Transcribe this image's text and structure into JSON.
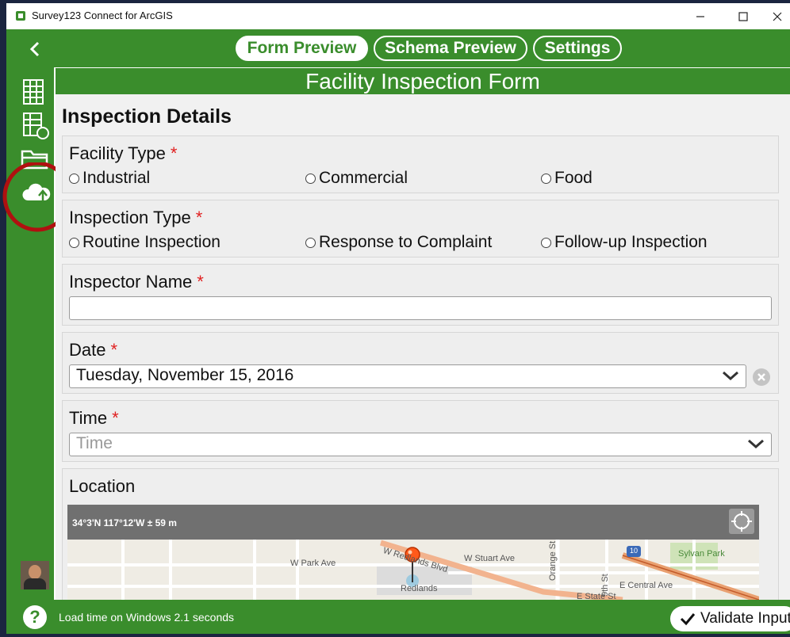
{
  "window": {
    "title": "Survey123 Connect for ArcGIS",
    "icon": "survey123-app-icon"
  },
  "window_controls": [
    "minimize-icon",
    "maximize-icon",
    "close-icon"
  ],
  "tabs": [
    {
      "label": "Form Preview",
      "active": true
    },
    {
      "label": "Schema Preview",
      "active": false
    },
    {
      "label": "Settings",
      "active": false
    }
  ],
  "sidebar": {
    "icons": [
      "back-arrow-icon",
      "spreadsheet-icon",
      "spreadsheet-refresh-icon",
      "folder-icon",
      "cloud-upload-icon",
      "user-avatar",
      "help-icon"
    ]
  },
  "form": {
    "title": "Facility Inspection Form",
    "group_title": "Inspection Details",
    "facility_type": {
      "label": "Facility Type",
      "required_mark": "*",
      "options": [
        "Industrial",
        "Commercial",
        "Food"
      ]
    },
    "inspection_type": {
      "label": "Inspection Type",
      "required_mark": "*",
      "options": [
        "Routine Inspection",
        "Response to Complaint",
        "Follow-up Inspection"
      ]
    },
    "inspector_name": {
      "label": "Inspector Name",
      "required_mark": "*",
      "value": ""
    },
    "date": {
      "label": "Date",
      "required_mark": "*",
      "value": "Tuesday, November 15, 2016"
    },
    "time": {
      "label": "Time",
      "required_mark": "*",
      "placeholder": "Time"
    },
    "location": {
      "label": "Location",
      "coordinates": "34°3'N 117°12'W ± 59 m",
      "streets": [
        "W Redlands Blvd",
        "W Stuart Ave",
        "W Park Ave",
        "Orange St",
        "9th St",
        "E Central Ave",
        "E State St",
        "Sylvan Park",
        "Redlands",
        "10"
      ]
    }
  },
  "footer": {
    "status_text": "Load time on Windows 2.1 seconds",
    "validate_label": "Validate Input"
  },
  "colors": {
    "brand_green": "#3a8d2c",
    "required_red": "#e02020",
    "annotation_red": "#b01010"
  }
}
